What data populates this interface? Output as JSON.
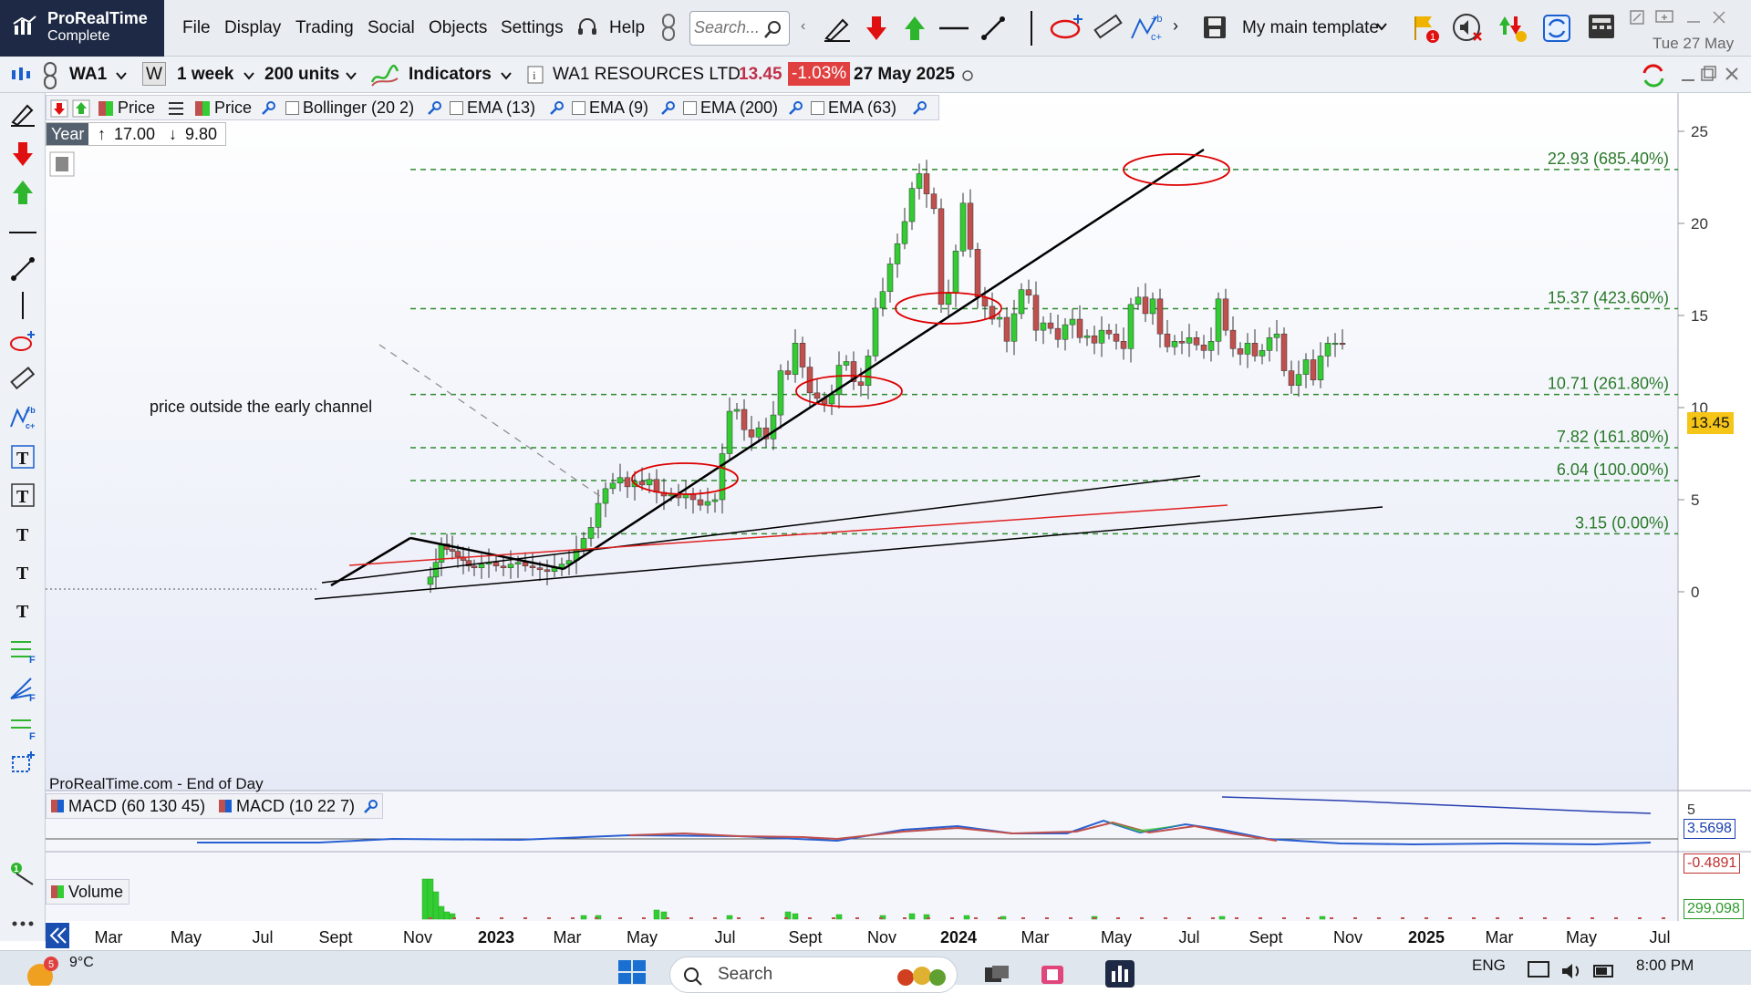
{
  "app": {
    "brand_name": "ProRealTime",
    "brand_edition": "Complete",
    "menu": [
      "File",
      "Display",
      "Trading",
      "Social",
      "Objects",
      "Settings",
      "Help"
    ],
    "search_placeholder": "Search...",
    "template_label": "My main template",
    "date": "Tue 27 May"
  },
  "toolbar": {
    "ticker": "WA1",
    "period_code": "W",
    "timeframe": "1 week",
    "units": "200 units",
    "indicators_label": "Indicators",
    "instrument_name": "WA1 RESOURCES LTD",
    "last_price": "13.45",
    "change_pct": "-1.03%",
    "quote_date": "27 May 2025"
  },
  "overlays": {
    "price_label_1": "Price",
    "price_label_2": "Price",
    "items": [
      "Bollinger (20 2)",
      "EMA (13)",
      "EMA (9)",
      "EMA (200)",
      "EMA (63)"
    ],
    "year_label": "Year",
    "year_high": "17.00",
    "year_low": "9.80"
  },
  "chart": {
    "annotation": "price outside the early channel",
    "source_note": "ProRealTime.com - End of Day",
    "current_price_label": "13.45",
    "fib_levels": [
      {
        "value": 22.93,
        "label": "22.93 (685.40%)"
      },
      {
        "value": 15.37,
        "label": "15.37 (423.60%)"
      },
      {
        "value": 10.71,
        "label": "10.71 (261.80%)"
      },
      {
        "value": 7.82,
        "label": "7.82 (161.80%)"
      },
      {
        "value": 6.04,
        "label": "6.04 (100.00%)"
      },
      {
        "value": 3.15,
        "label": "3.15 (0.00%)"
      }
    ],
    "y_ticks": [
      "25",
      "20",
      "15",
      "10",
      "5",
      "0"
    ],
    "macd_label_1": "MACD (60 130 45)",
    "macd_label_2": "MACD (10 22 7)",
    "macd_tick": "5",
    "macd_value_1": "3.5698",
    "macd_value_2": "-0.4891",
    "volume_label": "Volume",
    "volume_value": "299,098",
    "x_labels": [
      {
        "text": "Mar",
        "bold": false
      },
      {
        "text": "May",
        "bold": false
      },
      {
        "text": "Jul",
        "bold": false
      },
      {
        "text": "Sept",
        "bold": false
      },
      {
        "text": "Nov",
        "bold": false
      },
      {
        "text": "2023",
        "bold": true
      },
      {
        "text": "Mar",
        "bold": false
      },
      {
        "text": "May",
        "bold": false
      },
      {
        "text": "Jul",
        "bold": false
      },
      {
        "text": "Sept",
        "bold": false
      },
      {
        "text": "Nov",
        "bold": false
      },
      {
        "text": "2024",
        "bold": true
      },
      {
        "text": "Mar",
        "bold": false
      },
      {
        "text": "May",
        "bold": false
      },
      {
        "text": "Jul",
        "bold": false
      },
      {
        "text": "Sept",
        "bold": false
      },
      {
        "text": "Nov",
        "bold": false
      },
      {
        "text": "2025",
        "bold": true
      },
      {
        "text": "Mar",
        "bold": false
      },
      {
        "text": "May",
        "bold": false
      },
      {
        "text": "Jul",
        "bold": false
      }
    ],
    "colors": {
      "bull": "#33cc33",
      "bear": "#c0504d",
      "fib": "#2e8b2e",
      "ellipse": "#dd0000",
      "channel_mid": "#e02020",
      "price_badge": "#f5c518",
      "change_badge": "#e04040"
    }
  },
  "taskbar": {
    "weather_temp": "9°C",
    "weather_badge": "5",
    "search_label": "Search",
    "language": "ENG",
    "time": "8:00 PM"
  }
}
